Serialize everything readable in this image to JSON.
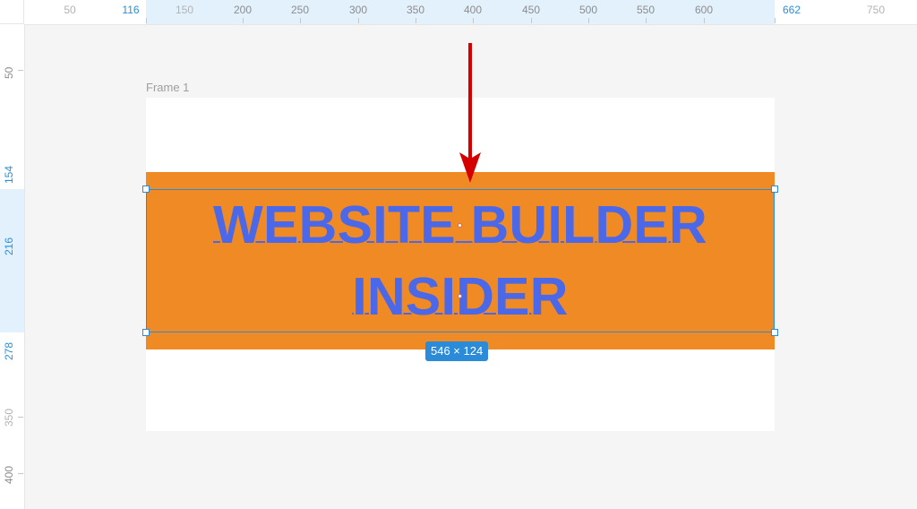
{
  "ruler_top": {
    "ticks": [
      "50",
      "116",
      "150",
      "200",
      "250",
      "300",
      "350",
      "400",
      "450",
      "500",
      "550",
      "600",
      "662",
      "750"
    ],
    "selection_start": "116",
    "selection_end": "662"
  },
  "ruler_left": {
    "ticks": [
      "50",
      "154",
      "216",
      "278",
      "350",
      "400"
    ],
    "selection_start": "154",
    "selection_mid": "216",
    "selection_end": "278"
  },
  "canvas": {
    "frame_label": "Frame 1",
    "headline_line1": "WEBSITE BUILDER",
    "headline_line2": "INSIDER",
    "size_badge": "546 × 124"
  },
  "colors": {
    "canvas_bg": "#f5f5f5",
    "orange": "#f08a24",
    "text_blue": "#4a68e8",
    "selection_blue": "#2c8bd8",
    "arrow_red": "#d40000"
  },
  "icons": {
    "annotation": "down-arrow-icon"
  }
}
